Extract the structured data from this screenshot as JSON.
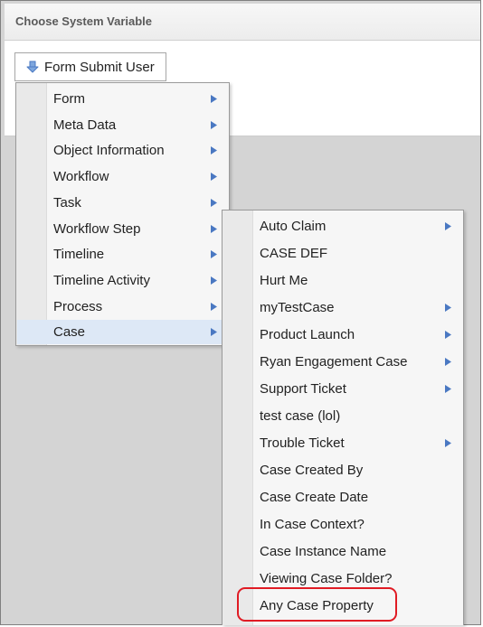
{
  "dialog": {
    "title": "Choose System Variable",
    "variable_button": {
      "label": "Form Submit User",
      "icon": "down-arrow-icon"
    }
  },
  "menu_level1": {
    "items": [
      {
        "label": "Form",
        "has_submenu": true
      },
      {
        "label": "Meta Data",
        "has_submenu": true
      },
      {
        "label": "Object Information",
        "has_submenu": true
      },
      {
        "label": "Workflow",
        "has_submenu": true
      },
      {
        "label": "Task",
        "has_submenu": true
      },
      {
        "label": "Workflow Step",
        "has_submenu": true
      },
      {
        "label": "Timeline",
        "has_submenu": true
      },
      {
        "label": "Timeline Activity",
        "has_submenu": true
      },
      {
        "label": "Process",
        "has_submenu": true
      },
      {
        "label": "Case",
        "has_submenu": true,
        "active": true
      }
    ]
  },
  "menu_level2": {
    "items": [
      {
        "label": "Auto Claim",
        "has_submenu": true
      },
      {
        "label": "CASE DEF",
        "has_submenu": false
      },
      {
        "label": "Hurt Me",
        "has_submenu": false
      },
      {
        "label": "myTestCase",
        "has_submenu": true
      },
      {
        "label": "Product Launch",
        "has_submenu": true
      },
      {
        "label": "Ryan Engagement Case",
        "has_submenu": true
      },
      {
        "label": "Support Ticket",
        "has_submenu": true
      },
      {
        "label": "test case (lol)",
        "has_submenu": false
      },
      {
        "label": "Trouble Ticket",
        "has_submenu": true
      },
      {
        "label": "Case Created By",
        "has_submenu": false
      },
      {
        "label": "Case Create Date",
        "has_submenu": false
      },
      {
        "label": "In Case Context?",
        "has_submenu": false
      },
      {
        "label": "Case Instance Name",
        "has_submenu": false
      },
      {
        "label": "Viewing Case Folder?",
        "has_submenu": false
      },
      {
        "label": "Any Case Property",
        "has_submenu": false,
        "highlighted": true
      }
    ]
  },
  "colors": {
    "highlight_ring": "#e01b24",
    "active_item_bg": "#dde8f6",
    "submenu_arrow": "#4a78c2"
  }
}
